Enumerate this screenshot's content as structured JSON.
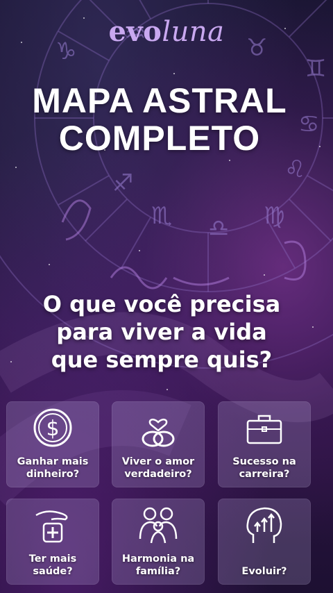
{
  "brand": {
    "logo_part_1": "evo",
    "logo_part_2": "luna",
    "color": "#c9a8f0"
  },
  "headline": {
    "line1": "MAPA ASTRAL",
    "line2": "COMPLETO"
  },
  "question": {
    "line1": "O que você precisa",
    "line2": "para viver  a vida",
    "line3": "que sempre quis?"
  },
  "options": [
    {
      "label": "Ganhar mais\ndinheiro?",
      "icon": "dollar-coin-icon"
    },
    {
      "label": "Viver o amor\nverdadeiro?",
      "icon": "wedding-rings-heart-icon"
    },
    {
      "label": "Sucesso na\ncarreira?",
      "icon": "briefcase-icon"
    },
    {
      "label": "Ter mais\nsaúde?",
      "icon": "health-hand-cross-icon"
    },
    {
      "label": "Harmonia na\nfamília?",
      "icon": "family-icon"
    },
    {
      "label": "Evoluir?",
      "icon": "growth-mind-icon"
    }
  ],
  "colors": {
    "card_background": "rgba(200,185,235,0.22)",
    "text": "#ffffff",
    "zodiac_lines": "#8e6fc7"
  }
}
